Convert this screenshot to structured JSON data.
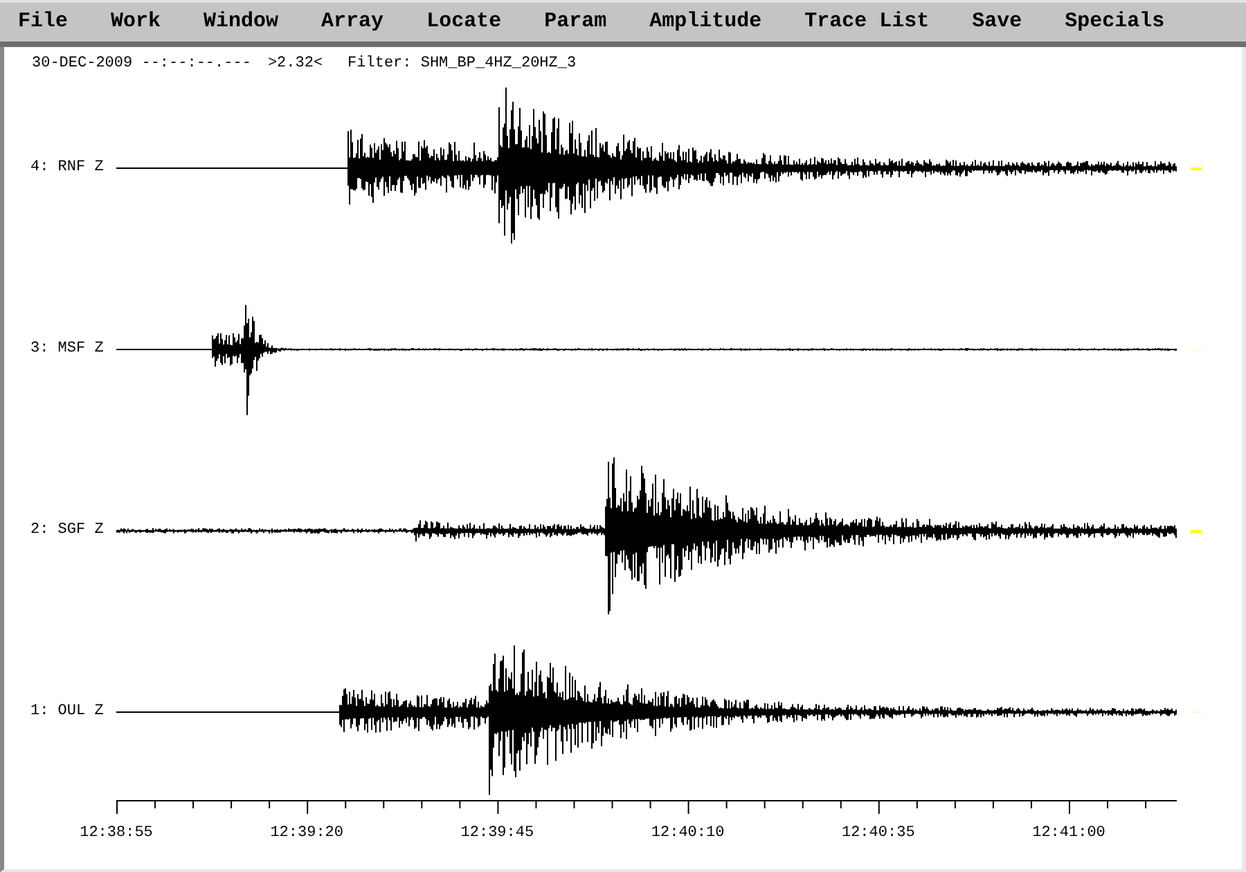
{
  "menu": [
    {
      "label": "File"
    },
    {
      "label": "Work"
    },
    {
      "label": "Window"
    },
    {
      "label": "Array"
    },
    {
      "label": "Locate"
    },
    {
      "label": "Param"
    },
    {
      "label": "Amplitude"
    },
    {
      "label": "Trace List"
    },
    {
      "label": "Save"
    },
    {
      "label": "Specials"
    }
  ],
  "header": {
    "time": "30-DEC-2009 --:--:--.---",
    "amplitude": ">2.32<",
    "filter": "Filter: SHM_BP_4HZ_20HZ_3"
  },
  "traces": [
    {
      "label": "4: RNF Z",
      "marked": true
    },
    {
      "label": "3: MSF Z",
      "marked": false
    },
    {
      "label": "2: SGF Z",
      "marked": true
    },
    {
      "label": "1: OUL Z",
      "marked": false
    }
  ],
  "time_axis": {
    "labels": [
      "12:38:55",
      "12:39:20",
      "12:39:45",
      "12:40:10",
      "12:40:35",
      "12:41:00"
    ]
  }
}
